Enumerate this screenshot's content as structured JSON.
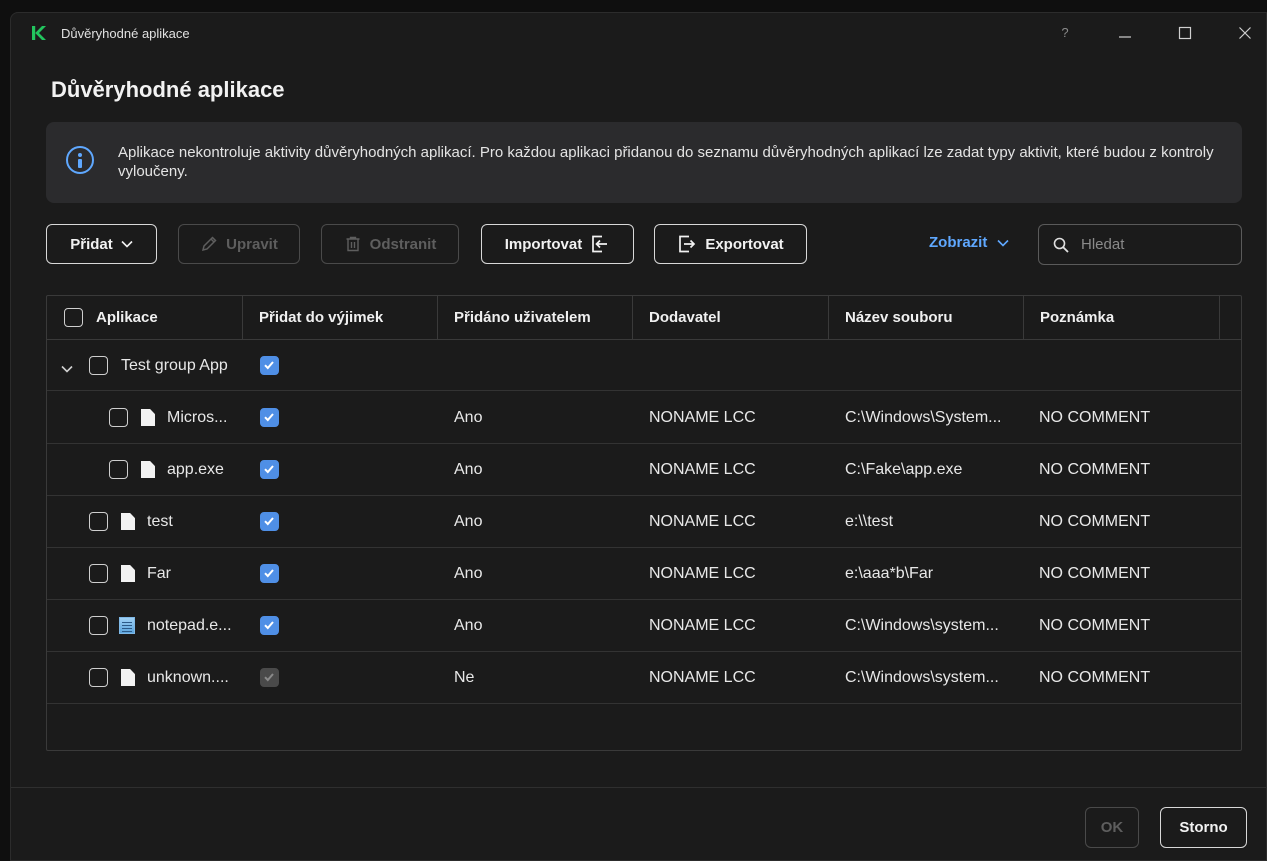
{
  "window": {
    "title": "Důvěryhodné aplikace",
    "controls": {
      "help": "?"
    }
  },
  "page": {
    "title": "Důvěryhodné aplikace"
  },
  "banner": {
    "text": "Aplikace nekontroluje aktivity důvěryhodných aplikací. Pro každou aplikaci přidanou do seznamu důvěryhodných aplikací lze zadat typy aktivit, které budou z kontroly vyloučeny."
  },
  "toolbar": {
    "add_label": "Přidat",
    "edit_label": "Upravit",
    "delete_label": "Odstranit",
    "import_label": "Importovat",
    "export_label": "Exportovat",
    "view_label": "Zobrazit",
    "search_placeholder": "Hledat"
  },
  "table": {
    "columns": [
      "Aplikace",
      "Přidat do výjimek",
      "Přidáno uživatelem",
      "Dodavatel",
      "Název souboru",
      "Poznámka"
    ],
    "group": {
      "name": "Test group App",
      "expanded": true,
      "selected": false,
      "exclude": true
    },
    "rows": [
      {
        "name": "Micros...",
        "icon": "file-icon",
        "in_group": true,
        "selected": false,
        "exclude": true,
        "exclude_disabled": false,
        "added_by_user": "Ano",
        "vendor": "NONAME LCC",
        "file": "C:\\Windows\\System...",
        "note": "NO COMMENT"
      },
      {
        "name": "app.exe",
        "icon": "file-icon",
        "in_group": true,
        "selected": false,
        "exclude": true,
        "exclude_disabled": false,
        "added_by_user": "Ano",
        "vendor": "NONAME LCC",
        "file": "C:\\Fake\\app.exe",
        "note": "NO COMMENT"
      },
      {
        "name": "test",
        "icon": "file-icon",
        "in_group": false,
        "selected": false,
        "exclude": true,
        "exclude_disabled": false,
        "added_by_user": "Ano",
        "vendor": "NONAME LCC",
        "file": "e:\\\\test",
        "note": "NO COMMENT"
      },
      {
        "name": "Far",
        "icon": "file-icon",
        "in_group": false,
        "selected": false,
        "exclude": true,
        "exclude_disabled": false,
        "added_by_user": "Ano",
        "vendor": "NONAME LCC",
        "file": "e:\\aaa*b\\Far",
        "note": "NO COMMENT"
      },
      {
        "name": "notepad.e...",
        "icon": "notepad-icon",
        "in_group": false,
        "selected": false,
        "exclude": true,
        "exclude_disabled": false,
        "added_by_user": "Ano",
        "vendor": "NONAME LCC",
        "file": "C:\\Windows\\system...",
        "note": "NO COMMENT"
      },
      {
        "name": "unknown....",
        "icon": "file-icon",
        "in_group": false,
        "selected": false,
        "exclude": true,
        "exclude_disabled": true,
        "added_by_user": "Ne",
        "vendor": "NONAME LCC",
        "file": "C:\\Windows\\system...",
        "note": "NO COMMENT"
      }
    ]
  },
  "footer": {
    "ok_label": "OK",
    "cancel_label": "Storno"
  },
  "colors": {
    "accent": "#4f8fe6",
    "link": "#5fa8ff",
    "background": "#1b1b1b",
    "logo": "#22c55e"
  }
}
